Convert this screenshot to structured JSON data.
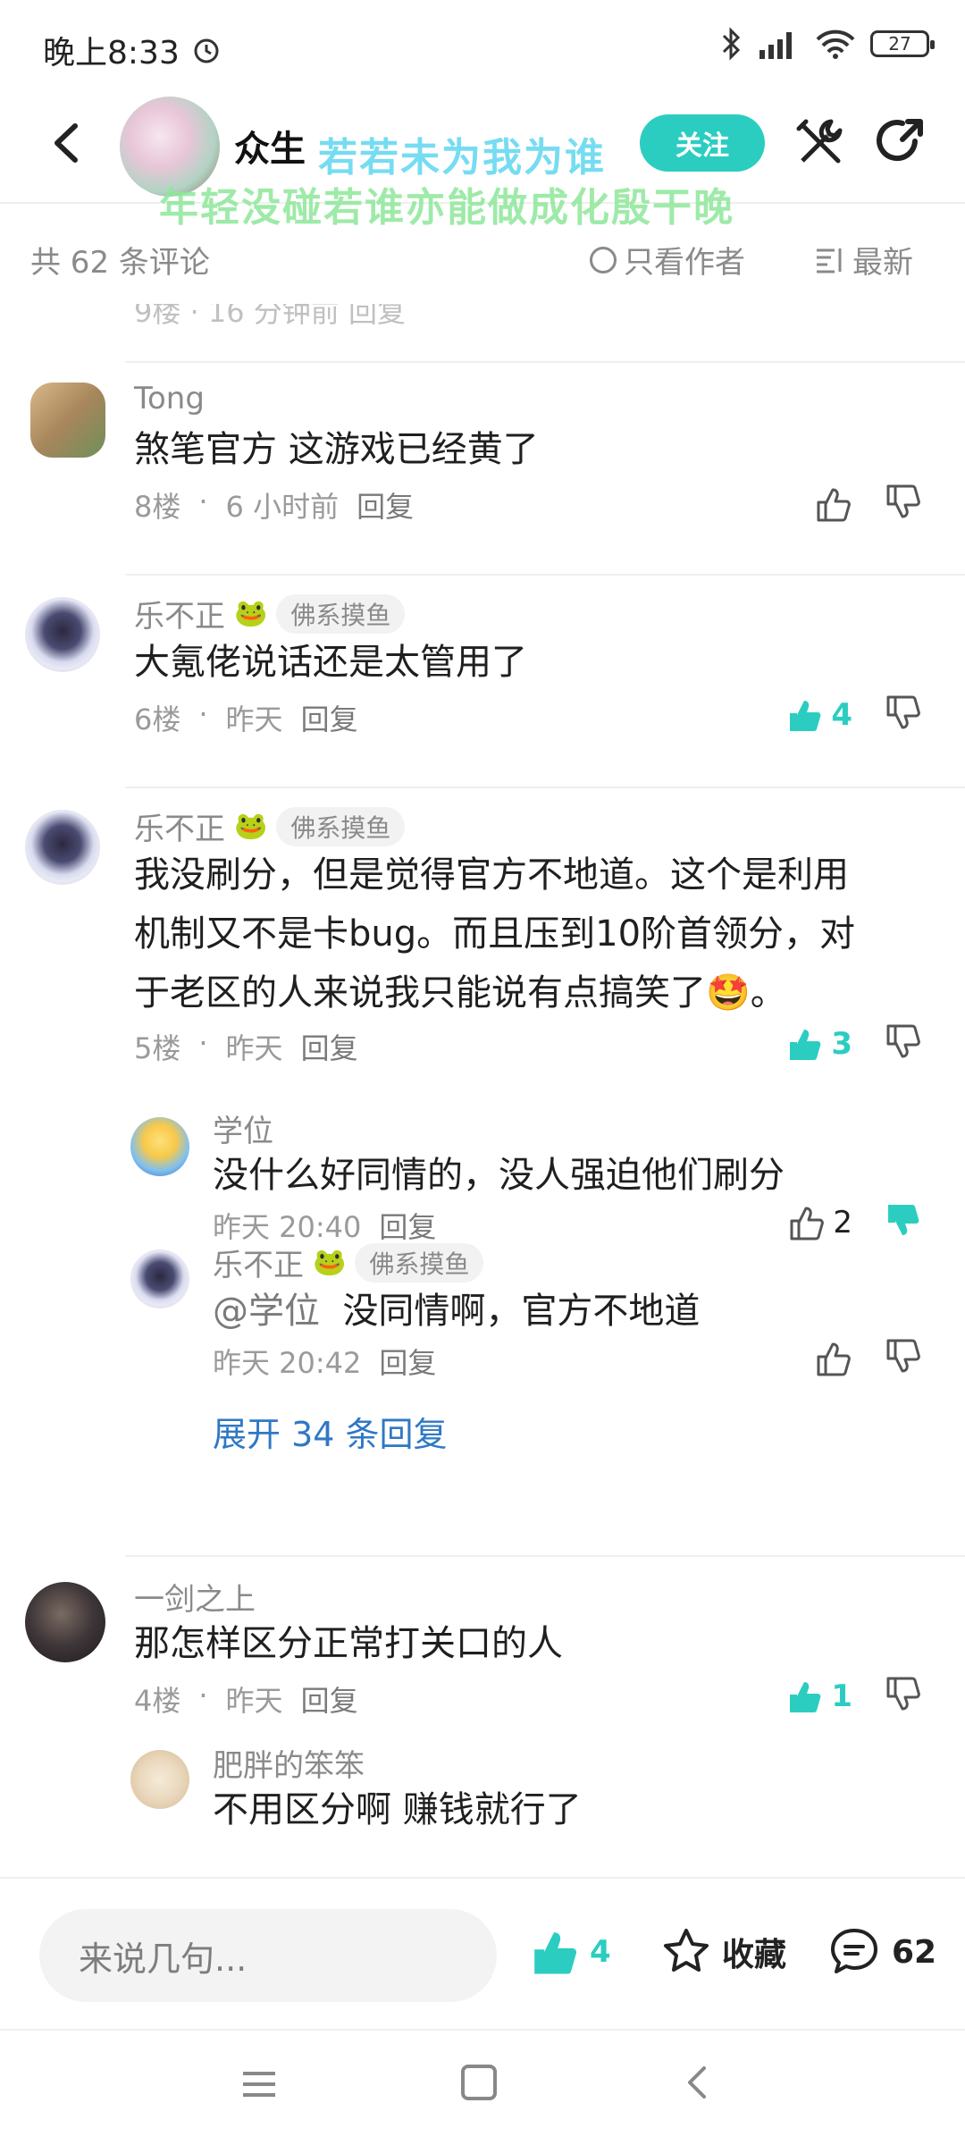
{
  "status_bar": {
    "time": "晚上8:33",
    "battery": "27"
  },
  "header": {
    "username": "众生",
    "follow_label": "关注",
    "banner_line1": "若若未为我为谁",
    "banner_line2": "年轻没碰若谁亦能做成化殷干晚"
  },
  "filter_bar": {
    "count_label": "共 62 条评论",
    "only_author_label": "只看作者",
    "sort_label": "最新"
  },
  "comments": [
    {
      "username": "Tong",
      "content": "煞笔官方 这游戏已经黄了",
      "floor": "8楼",
      "time": "6 小时前",
      "reply_label": "回复",
      "like_count": ""
    },
    {
      "username": "乐不正",
      "badge": "佛系摸鱼",
      "content": "大氪佬说话还是太管用了",
      "floor": "6楼",
      "time": "昨天",
      "reply_label": "回复",
      "like_count": "4"
    },
    {
      "username": "乐不正",
      "badge": "佛系摸鱼",
      "content_line1": "我没刷分，但是觉得官方不地道。这个是利用",
      "content_line2": "机制又不是卡bug。而且压到10阶首领分，对",
      "content_line3": "于老区的人来说我只能说有点搞笑了🤩。",
      "floor": "5楼",
      "time": "昨天",
      "reply_label": "回复",
      "like_count": "3",
      "replies": [
        {
          "username": "学位",
          "content": "没什么好同情的，没人强迫他们刷分",
          "time": "昨天 20:40",
          "reply_label": "回复",
          "like_count": "2"
        },
        {
          "username": "乐不正",
          "badge": "佛系摸鱼",
          "mention": "@学位",
          "content": "没同情啊，官方不地道",
          "time": "昨天 20:42",
          "reply_label": "回复"
        }
      ],
      "expand_label": "展开 34 条回复"
    },
    {
      "username": "一剑之上",
      "content": "那怎样区分正常打关口的人",
      "floor": "4楼",
      "time": "昨天",
      "reply_label": "回复",
      "like_count": "1",
      "replies": [
        {
          "username": "肥胖的笨笨",
          "content": "不用区分啊 赚钱就行了"
        }
      ]
    }
  ],
  "bottom_bar": {
    "input_placeholder": "来说几句...",
    "like_count": "4",
    "favorite_label": "收藏",
    "comment_count": "62"
  },
  "colors": {
    "accent": "#2ccdc1",
    "link": "#2f78c4"
  }
}
